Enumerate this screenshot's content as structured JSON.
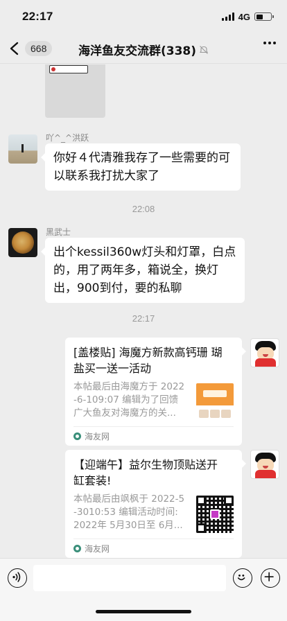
{
  "status_bar": {
    "time": "22:17",
    "network": "4G",
    "battery_level": 0.45
  },
  "nav": {
    "unread_count": "668",
    "title": "海洋鱼友交流群(338)",
    "icons": [
      "back-arrow-icon",
      "mute-icon",
      "more-icon"
    ]
  },
  "messages": [
    {
      "sender": "吖^_^洪跃",
      "text": "你好４代清雅我存了一些需要的可以联系我打扰大家了",
      "lines": [
        "你好４代清雅我存了一些需要的可",
        "以联系我打扰大家了"
      ]
    },
    {
      "sender": "黑武士",
      "lines": [
        "出个kessil360w灯头和灯罩，白点",
        "的，用了两年多，箱说全，换灯",
        "出，900到付，要的私聊"
      ]
    }
  ],
  "timestamps": [
    "22:08",
    "22:17"
  ],
  "cards": [
    {
      "title_lines": [
        "[盖楼贴] 海魔方新款高钙珊 瑚",
        "盐买一送一活动"
      ],
      "desc_lines": [
        "本帖最后由海魔方于 2022",
        "-6-109:07 编辑为了回馈",
        "广大鱼友对海魔方的关..."
      ],
      "source": "海友网"
    },
    {
      "title_lines": [
        "【迎端午】益尔生物顶贴送开",
        "缸套装!"
      ],
      "desc_lines": [
        "本帖最后由飒枫于 2022-5",
        "-3010:53 编辑活动时间:",
        "2022年 5月30日至 6月..."
      ],
      "source": "海友网"
    }
  ],
  "input": {
    "placeholder": "",
    "icons": [
      "voice-icon",
      "emoji-icon",
      "plus-icon"
    ]
  }
}
